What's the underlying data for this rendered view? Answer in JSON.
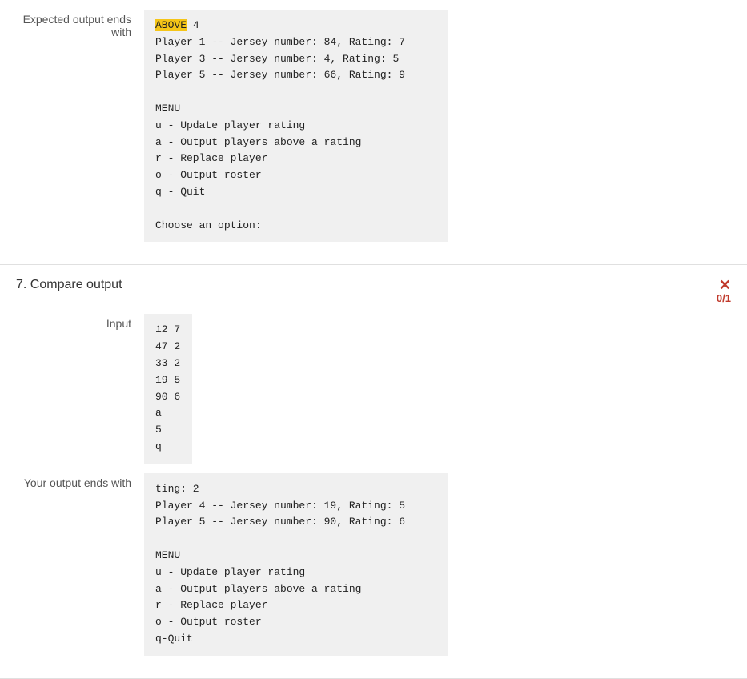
{
  "section6": {
    "label": "Expected output ends with",
    "expected_output_lines": [
      {
        "text": "ABOVE 4",
        "highlight": "ABOVE"
      },
      {
        "text": "Player 1 -- Jersey number: 84, Rating: 7",
        "highlight": null
      },
      {
        "text": "Player 3 -- Jersey number: 4, Rating: 5",
        "highlight": null
      },
      {
        "text": "Player 5 -- Jersey number: 66, Rating: 9",
        "highlight": null
      },
      {
        "text": "",
        "highlight": null
      },
      {
        "text": "MENU",
        "highlight": null
      },
      {
        "text": "u - Update player rating",
        "highlight": null
      },
      {
        "text": "a - Output players above a rating",
        "highlight": null
      },
      {
        "text": "r - Replace player",
        "highlight": null
      },
      {
        "text": "o - Output roster",
        "highlight": null
      },
      {
        "text": "q - Quit",
        "highlight": null
      },
      {
        "text": "",
        "highlight": null
      },
      {
        "text": "Choose an option:",
        "highlight": null
      }
    ]
  },
  "section7": {
    "title": "7. Compare output",
    "score": "0/1",
    "close_symbol": "✕",
    "input_label": "Input",
    "input_lines": [
      "12 7",
      "47 2",
      "33 2",
      "19 5",
      "90 6",
      "a",
      "5",
      "q"
    ],
    "your_output_label": "Your output ends with",
    "your_output_lines": [
      "ting: 2",
      "Player 4 -- Jersey number: 19, Rating: 5",
      "Player 5 -- Jersey number: 90, Rating: 6",
      "",
      "MENU",
      "u - Update player rating",
      "a - Output players above a rating",
      "r - Replace player",
      "o - Output roster",
      "q-Quit"
    ]
  }
}
